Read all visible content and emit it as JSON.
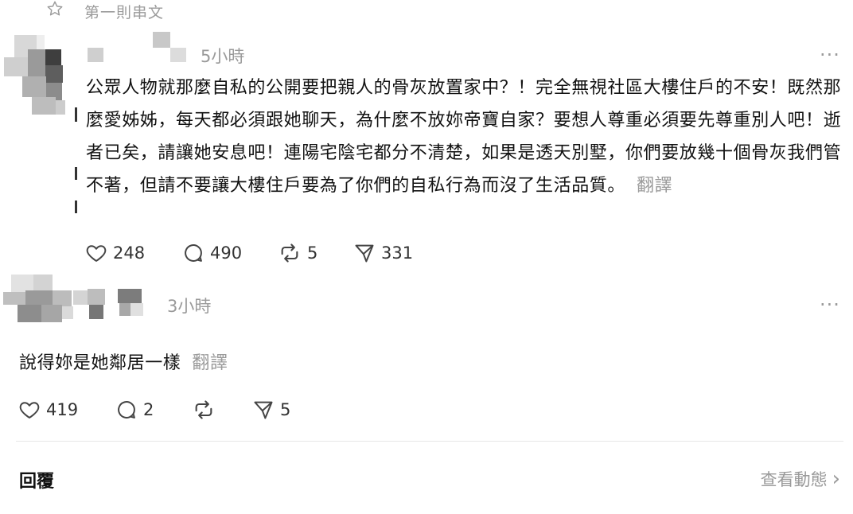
{
  "header": {
    "first_post_label": "第一則串文"
  },
  "post": {
    "time": "5小時",
    "more": "···",
    "text": "公眾人物就那麼自私的公開要把親人的骨灰放置家中？！完全無視社區大樓住戶的不安！既然那麼愛姊姊，每天都必須跟她聊天，為什麼不放妳帝寶自家？要想人尊重必須要先尊重別人吧！逝者已矣，請讓她安息吧！連陽宅陰宅都分不清楚，如果是透天別墅，你們要放幾十個骨灰我們管不著，但請不要讓大樓住戶要為了你們的自私行為而沒了生活品質。",
    "translate": "翻譯",
    "likes": "248",
    "comments": "490",
    "reposts": "5",
    "shares": "331"
  },
  "reply": {
    "time": "3小時",
    "more": "···",
    "text": "說得妳是她鄰居一樣",
    "translate": "翻譯",
    "likes": "419",
    "comments": "2",
    "reposts": "",
    "shares": "5"
  },
  "footer": {
    "reply_label": "回覆",
    "view_activity": "查看動態",
    "chevron": "›"
  },
  "icons": [
    "star-icon",
    "heart-icon",
    "comment-icon",
    "repost-icon",
    "share-icon",
    "chevron-right-icon"
  ]
}
